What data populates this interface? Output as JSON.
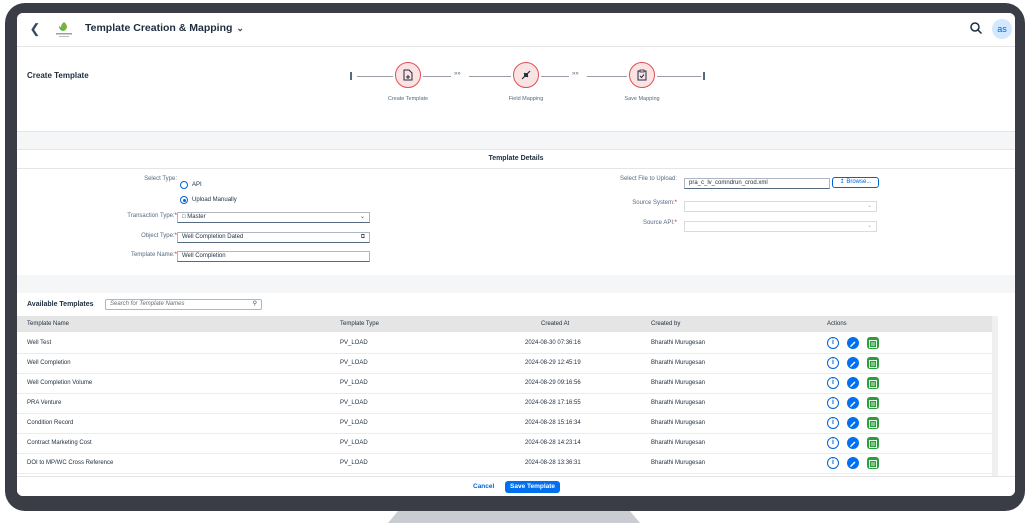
{
  "shell": {
    "title": "Template Creation & Mapping",
    "logo_text": "company",
    "avatar": "as"
  },
  "create": {
    "title": "Create Template",
    "steps": [
      {
        "label": "Create Template",
        "icon": "file-add-icon"
      },
      {
        "label": "Field Mapping",
        "icon": "compass-icon"
      },
      {
        "label": "Save Mapping",
        "icon": "clipboard-check-icon"
      }
    ]
  },
  "details": {
    "heading": "Template Details",
    "select_type_label": "Select Type:",
    "type_options": [
      "API",
      "Upload Manually"
    ],
    "selected_type": "Upload Manually",
    "transaction_type_label": "Transaction Type:",
    "transaction_type_value": "Master",
    "object_type_label": "Object Type:",
    "object_type_value": "Well Completion Dated",
    "template_name_label": "Template Name:",
    "template_name_value": "Well Completion",
    "file_label": "Select File to Upload:",
    "file_value": "pra_c_lv_comndrun_crod.xml",
    "browse_label": "Browse...",
    "source_system_label": "Source System:",
    "source_system_value": "",
    "source_api_label": "Source API:",
    "source_api_value": ""
  },
  "templates": {
    "title": "Available Templates",
    "search_placeholder": "Search for Template Names",
    "columns": [
      "Template Name",
      "Template Type",
      "Created At",
      "Created by",
      "Actions"
    ],
    "rows": [
      {
        "name": "Well Test",
        "type": "PV_LOAD",
        "created_at": "2024-08-30 07:36:16",
        "created_by": "Bharathi Murugesan"
      },
      {
        "name": "Well Completion",
        "type": "PV_LOAD",
        "created_at": "2024-08-29 12:45:19",
        "created_by": "Bharathi Murugesan"
      },
      {
        "name": "Well Completion Volume",
        "type": "PV_LOAD",
        "created_at": "2024-08-29 09:16:56",
        "created_by": "Bharathi Murugesan"
      },
      {
        "name": "PRA Venture",
        "type": "PV_LOAD",
        "created_at": "2024-08-28 17:16:55",
        "created_by": "Bharathi Murugesan"
      },
      {
        "name": "Condition Record",
        "type": "PV_LOAD",
        "created_at": "2024-08-28 15:16:34",
        "created_by": "Bharathi Murugesan"
      },
      {
        "name": "Contract Marketing Cost",
        "type": "PV_LOAD",
        "created_at": "2024-08-28 14:23:14",
        "created_by": "Bharathi Murugesan"
      },
      {
        "name": "DOI to MP/WC Cross Reference",
        "type": "PV_LOAD",
        "created_at": "2024-08-28 13:36:31",
        "created_by": "Bharathi Murugesan"
      }
    ]
  },
  "footer": {
    "cancel_label": "Cancel",
    "save_label": "Save Template"
  },
  "colors": {
    "accent": "#0070f2",
    "step_ring": "#e24e55",
    "map_button": "#2b9e3c"
  }
}
